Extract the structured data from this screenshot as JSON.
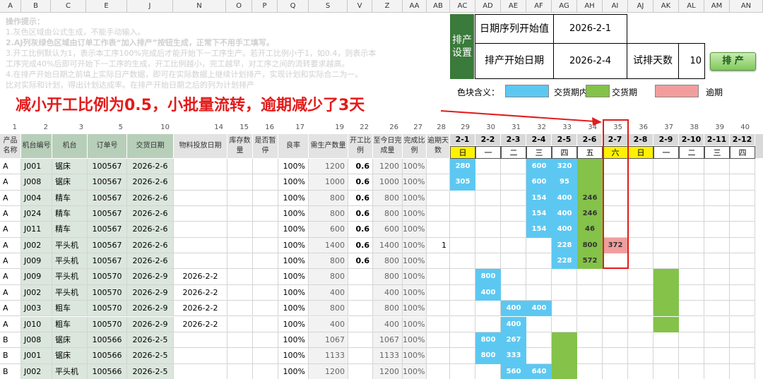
{
  "col_letters": [
    {
      "t": "A"
    },
    {
      "t": "B"
    },
    {
      "t": "C"
    },
    {
      "t": "E"
    },
    {
      "t": "J"
    },
    {
      "t": "N"
    },
    {
      "t": "O"
    },
    {
      "t": "P"
    },
    {
      "t": "Q"
    },
    {
      "t": "S"
    },
    {
      "t": "V"
    },
    {
      "t": "Z"
    },
    {
      "t": "AA"
    },
    {
      "t": "AB"
    },
    {
      "t": "AC"
    },
    {
      "t": "AD"
    },
    {
      "t": "AE"
    },
    {
      "t": "AF"
    },
    {
      "t": "AG"
    },
    {
      "t": "AH"
    },
    {
      "t": "AI"
    },
    {
      "t": "AJ"
    },
    {
      "t": "AK"
    },
    {
      "t": "AL"
    },
    {
      "t": "AM"
    },
    {
      "t": "AN"
    }
  ],
  "instructions": {
    "title": "操作提示：",
    "lines": [
      "1.灰色区域由公式生成，不能手动输入。",
      "2.AJ列灰绿色区域由订单工作表“加入排产”按钮生成，正常下不用手工填写。",
      "3.开工比例默认为1，表示本工序100%完成后才能开始下一工序生产。若开工比例小于1，如0.4，则表示本",
      "工序完成40%后即可开始下一工序的生成，开工比例越小，完工越早，对工序之间的流转要求越高。",
      "4.在排产开始日期之前填上实际日产数据，即可在实际数据上继续计划排产，实现计划和实际合二为一。",
      "比对实际和计划，得出计划达成率。在排产开始日期之后的列为计划排产"
    ]
  },
  "settings": {
    "section_label": "排产设置",
    "seq_start_label": "日期序列开始值",
    "seq_start_value": "2026-2-1",
    "prod_start_label": "排产开始日期",
    "prod_start_value": "2026-2-4",
    "trial_days_label": "试排天数",
    "trial_days_value": "10",
    "schedule_button": "排 产"
  },
  "legend": {
    "label": "色块含义：",
    "items": [
      {
        "text": "交货期内",
        "color": "#5cc8f2"
      },
      {
        "text": "交货期",
        "color": "#84c24a"
      },
      {
        "text": "逾期",
        "color": "#f19d9d"
      }
    ]
  },
  "annotation": "减小开工比例为0.5，小批量流转，逾期减少了3天",
  "index_numbers": [
    "1",
    "2",
    "3",
    "5",
    "10",
    "14",
    "15",
    "16",
    "17",
    "19",
    "22",
    "26",
    "27",
    "28"
  ],
  "headers": [
    "产品名称",
    "机台编号",
    "机台",
    "订单号",
    "交货日期",
    "物料投放日期",
    "库存数量",
    "是否暂停",
    "良率",
    "需生产数量",
    "开工比例",
    "至今日完成量",
    "完成比例",
    "逾期天数"
  ],
  "dates": [
    {
      "n": "29",
      "d": "2-1",
      "w": "日"
    },
    {
      "n": "30",
      "d": "2-2",
      "w": "一"
    },
    {
      "n": "31",
      "d": "2-3",
      "w": "二"
    },
    {
      "n": "32",
      "d": "2-4",
      "w": "三"
    },
    {
      "n": "33",
      "d": "2-5",
      "w": "四"
    },
    {
      "n": "34",
      "d": "2-6",
      "w": "五"
    },
    {
      "n": "35",
      "d": "2-7",
      "w": "六"
    },
    {
      "n": "36",
      "d": "2-8",
      "w": "日"
    },
    {
      "n": "37",
      "d": "2-9",
      "w": "一"
    },
    {
      "n": "38",
      "d": "2-10",
      "w": "二"
    },
    {
      "n": "39",
      "d": "2-11",
      "w": "三"
    },
    {
      "n": "40",
      "d": "2-12",
      "w": "四"
    }
  ],
  "rows": [
    {
      "p": "A",
      "code": "J001",
      "mach": "锯床",
      "order": "100567",
      "due": "2026-2-6",
      "mat": "",
      "stock": "",
      "pause": "",
      "yield": "100%",
      "qty": "1200",
      "ratio": "0.6",
      "done": "1200",
      "pct": "100%",
      "late": ""
    },
    {
      "p": "A",
      "code": "J008",
      "mach": "锯床",
      "order": "100567",
      "due": "2026-2-6",
      "mat": "",
      "stock": "",
      "pause": "",
      "yield": "100%",
      "qty": "1000",
      "ratio": "0.6",
      "done": "1000",
      "pct": "100%",
      "late": ""
    },
    {
      "p": "A",
      "code": "J004",
      "mach": "精车",
      "order": "100567",
      "due": "2026-2-6",
      "mat": "",
      "stock": "",
      "pause": "",
      "yield": "100%",
      "qty": "800",
      "ratio": "0.6",
      "done": "800",
      "pct": "100%",
      "late": ""
    },
    {
      "p": "A",
      "code": "J024",
      "mach": "精车",
      "order": "100567",
      "due": "2026-2-6",
      "mat": "",
      "stock": "",
      "pause": "",
      "yield": "100%",
      "qty": "800",
      "ratio": "0.6",
      "done": "800",
      "pct": "100%",
      "late": ""
    },
    {
      "p": "A",
      "code": "J011",
      "mach": "精车",
      "order": "100567",
      "due": "2026-2-6",
      "mat": "",
      "stock": "",
      "pause": "",
      "yield": "100%",
      "qty": "600",
      "ratio": "0.6",
      "done": "600",
      "pct": "100%",
      "late": ""
    },
    {
      "p": "A",
      "code": "J002",
      "mach": "平头机",
      "order": "100567",
      "due": "2026-2-6",
      "mat": "",
      "stock": "",
      "pause": "",
      "yield": "100%",
      "qty": "1400",
      "ratio": "0.6",
      "done": "1400",
      "pct": "100%",
      "late": "1"
    },
    {
      "p": "A",
      "code": "J009",
      "mach": "平头机",
      "order": "100567",
      "due": "2026-2-6",
      "mat": "",
      "stock": "",
      "pause": "",
      "yield": "100%",
      "qty": "800",
      "ratio": "0.6",
      "done": "800",
      "pct": "100%",
      "late": ""
    },
    {
      "p": "A",
      "code": "J009",
      "mach": "平头机",
      "order": "100570",
      "due": "2026-2-9",
      "mat": "2026-2-2",
      "stock": "",
      "pause": "",
      "yield": "100%",
      "qty": "800",
      "ratio": "",
      "done": "800",
      "pct": "100%",
      "late": ""
    },
    {
      "p": "A",
      "code": "J002",
      "mach": "平头机",
      "order": "100570",
      "due": "2026-2-9",
      "mat": "2026-2-2",
      "stock": "",
      "pause": "",
      "yield": "100%",
      "qty": "400",
      "ratio": "",
      "done": "400",
      "pct": "100%",
      "late": ""
    },
    {
      "p": "A",
      "code": "J003",
      "mach": "粗车",
      "order": "100570",
      "due": "2026-2-9",
      "mat": "2026-2-2",
      "stock": "",
      "pause": "",
      "yield": "100%",
      "qty": "800",
      "ratio": "",
      "done": "800",
      "pct": "100%",
      "late": ""
    },
    {
      "p": "A",
      "code": "J010",
      "mach": "粗车",
      "order": "100570",
      "due": "2026-2-9",
      "mat": "2026-2-2",
      "stock": "",
      "pause": "",
      "yield": "100%",
      "qty": "400",
      "ratio": "",
      "done": "400",
      "pct": "100%",
      "late": ""
    },
    {
      "p": "B",
      "code": "J008",
      "mach": "锯床",
      "order": "100566",
      "due": "2026-2-5",
      "mat": "",
      "stock": "",
      "pause": "",
      "yield": "100%",
      "qty": "1067",
      "ratio": "",
      "done": "1067",
      "pct": "100%",
      "late": ""
    },
    {
      "p": "B",
      "code": "J001",
      "mach": "锯床",
      "order": "100566",
      "due": "2026-2-5",
      "mat": "",
      "stock": "",
      "pause": "",
      "yield": "100%",
      "qty": "1133",
      "ratio": "",
      "done": "1133",
      "pct": "100%",
      "late": ""
    },
    {
      "p": "B",
      "code": "J002",
      "mach": "平头机",
      "order": "100566",
      "due": "2026-2-5",
      "mat": "",
      "stock": "",
      "pause": "",
      "yield": "100%",
      "qty": "1200",
      "ratio": "",
      "done": "1200",
      "pct": "100%",
      "late": ""
    }
  ],
  "gantt": [
    {
      "row": 0,
      "day": 0,
      "v": "280",
      "c": "blue"
    },
    {
      "row": 0,
      "day": 3,
      "v": "600",
      "c": "blue"
    },
    {
      "row": 0,
      "day": 4,
      "v": "320",
      "c": "blue"
    },
    {
      "row": 0,
      "day": 5,
      "v": "",
      "c": "green"
    },
    {
      "row": 1,
      "day": 0,
      "v": "305",
      "c": "blue"
    },
    {
      "row": 1,
      "day": 3,
      "v": "600",
      "c": "blue"
    },
    {
      "row": 1,
      "day": 4,
      "v": "95",
      "c": "blue"
    },
    {
      "row": 1,
      "day": 5,
      "v": "",
      "c": "green"
    },
    {
      "row": 2,
      "day": 3,
      "v": "154",
      "c": "blue"
    },
    {
      "row": 2,
      "day": 4,
      "v": "400",
      "c": "blue"
    },
    {
      "row": 2,
      "day": 5,
      "v": "246",
      "c": "green"
    },
    {
      "row": 3,
      "day": 3,
      "v": "154",
      "c": "blue"
    },
    {
      "row": 3,
      "day": 4,
      "v": "400",
      "c": "blue"
    },
    {
      "row": 3,
      "day": 5,
      "v": "246",
      "c": "green"
    },
    {
      "row": 4,
      "day": 3,
      "v": "154",
      "c": "blue"
    },
    {
      "row": 4,
      "day": 4,
      "v": "400",
      "c": "blue"
    },
    {
      "row": 4,
      "day": 5,
      "v": "46",
      "c": "green"
    },
    {
      "row": 5,
      "day": 4,
      "v": "228",
      "c": "blue"
    },
    {
      "row": 5,
      "day": 5,
      "v": "800",
      "c": "green"
    },
    {
      "row": 5,
      "day": 6,
      "v": "372",
      "c": "red"
    },
    {
      "row": 6,
      "day": 4,
      "v": "228",
      "c": "blue"
    },
    {
      "row": 6,
      "day": 5,
      "v": "572",
      "c": "green"
    },
    {
      "row": 7,
      "day": 1,
      "v": "800",
      "c": "blue"
    },
    {
      "row": 7,
      "day": 8,
      "v": "",
      "c": "green"
    },
    {
      "row": 8,
      "day": 1,
      "v": "400",
      "c": "blue"
    },
    {
      "row": 8,
      "day": 8,
      "v": "",
      "c": "green"
    },
    {
      "row": 9,
      "day": 2,
      "v": "400",
      "c": "blue"
    },
    {
      "row": 9,
      "day": 3,
      "v": "400",
      "c": "blue"
    },
    {
      "row": 9,
      "day": 8,
      "v": "",
      "c": "green"
    },
    {
      "row": 10,
      "day": 2,
      "v": "400",
      "c": "blue"
    },
    {
      "row": 10,
      "day": 8,
      "v": "",
      "c": "green"
    },
    {
      "row": 11,
      "day": 1,
      "v": "800",
      "c": "blue"
    },
    {
      "row": 11,
      "day": 2,
      "v": "267",
      "c": "blue"
    },
    {
      "row": 11,
      "day": 4,
      "v": "",
      "c": "green"
    },
    {
      "row": 12,
      "day": 1,
      "v": "800",
      "c": "blue"
    },
    {
      "row": 12,
      "day": 2,
      "v": "333",
      "c": "blue"
    },
    {
      "row": 12,
      "day": 4,
      "v": "",
      "c": "green"
    },
    {
      "row": 13,
      "day": 2,
      "v": "560",
      "c": "blue"
    },
    {
      "row": 13,
      "day": 3,
      "v": "640",
      "c": "blue"
    },
    {
      "row": 13,
      "day": 4,
      "v": "",
      "c": "green"
    }
  ]
}
